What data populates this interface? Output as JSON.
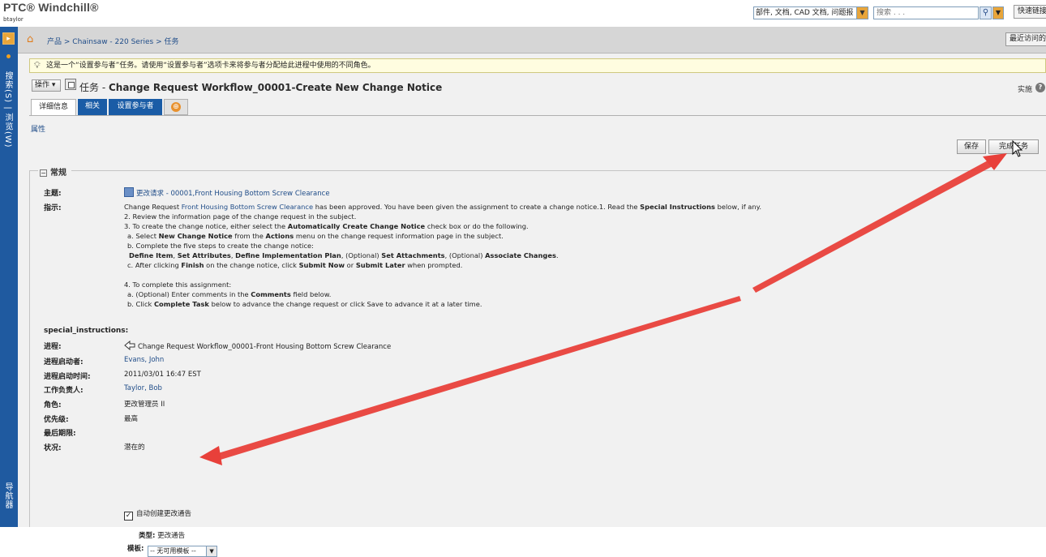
{
  "header": {
    "logo": "PTC® Windchill®",
    "user": "btaylor",
    "search_type": "部件, 文档, CAD 文档, 问题报",
    "search_placeholder": "搜索 . . .",
    "quick_links": "快速链接"
  },
  "leftnav": {
    "search_browse": "搜索(S) | 浏览(W)",
    "navigator": "导航器"
  },
  "breadcrumb": {
    "items": [
      "产品",
      "Chainsaw - 220 Series",
      "任务"
    ],
    "separator": " > ",
    "recent": "最近访问的"
  },
  "infobar": {
    "message": "这是一个“设置参与者”任务。请使用“设置参与者”选项卡来将参与者分配给此进程中使用的不同角色。"
  },
  "page": {
    "actions_label": "操作",
    "title_lead": "任务 - ",
    "title": "Change Request Workflow_00001-Create New Change Notice",
    "implementation": "实施",
    "tabs": [
      "详细信息",
      "相关",
      "设置参与者"
    ],
    "attributes_link": "属性",
    "save_label": "保存",
    "complete_label": "完成任务"
  },
  "section": {
    "heading": "常规",
    "subject_label": "主题:",
    "subject_link": "更改请求",
    "subject_rest": " - 00001,Front Housing Bottom Screw Clearance",
    "instructions_label": "指示:",
    "special_label": "special_instructions:",
    "process_label": "进程:",
    "process_value": "Change Request Workflow_00001-Front Housing Bottom Screw Clearance",
    "initiator_label": "进程启动者:",
    "initiator_value": "Evans, John",
    "start_time_label": "进程启动时间:",
    "start_time_value": "2011/03/01 16:47 EST",
    "owner_label": "工作负责人:",
    "owner_value": "Taylor, Bob",
    "role_label": "角色:",
    "role_value": "更改管理员 II",
    "priority_label": "优先级:",
    "priority_value": "最高",
    "deadline_label": "最后期限:",
    "status_label": "状况:",
    "status_value": "潜在的",
    "auto_create_label": "自动创建更改通告",
    "auto_create_checked": true,
    "type_label": "类型:",
    "type_value": "更改通告",
    "template_label": "模板:",
    "template_value": "-- 无可用模板 --"
  },
  "instructions": {
    "l1_a": "Change Request ",
    "l1_link": "Front Housing Bottom Screw Clearance",
    "l1_b": " has been approved. You have been given the assignment to create a change notice.1. Read the ",
    "l1_bold": "Special Instructions",
    "l1_c": " below, if any.",
    "l2": "2. Review the information page of the change request in the subject.",
    "l3_a": "3. To create the change notice, either select the ",
    "l3_bold": "Automatically Create Change Notice",
    "l3_b": " check box or do the following.",
    "l4_a": "  a. Select ",
    "l4_bold1": "New Change Notice",
    "l4_b": " from the ",
    "l4_bold2": "Actions",
    "l4_c": " menu on the change request information page in the subject.",
    "l5": "  b. Complete the five steps to create the change notice:",
    "l6_bold1": "Define Item",
    "l6_s1": ", ",
    "l6_bold2": "Set Attributes",
    "l6_s2": ", ",
    "l6_bold3": "Define Implementation Plan",
    "l6_s3": ", (Optional) ",
    "l6_bold4": "Set Attachments",
    "l6_s4": ", (Optional) ",
    "l6_bold5": "Associate Changes",
    "l6_s5": ".",
    "l7_a": "  c. After clicking ",
    "l7_bold1": "Finish",
    "l7_b": " on the change notice, click ",
    "l7_bold2": "Submit Now",
    "l7_c": " or ",
    "l7_bold3": "Submit Later",
    "l7_d": " when prompted.",
    "l8": "4. To complete this assignment:",
    "l9_a": "  a. (Optional) Enter comments in the ",
    "l9_bold": "Comments",
    "l9_b": " field below.",
    "l10_a": "  b. Click ",
    "l10_bold": "Complete Task",
    "l10_b": " below to advance the change request or click Save to advance it at a later time."
  },
  "colors": {
    "nav_blue": "#1f5aa0",
    "tab_blue": "#1a5ca6",
    "link_blue": "#1f4c88",
    "annotation_red": "#e8403a",
    "accent_orange": "#e8912e"
  },
  "icons": [
    "home-icon",
    "bulb-icon",
    "task-icon",
    "help-icon",
    "subject-icon",
    "process-icon",
    "collapse-icon",
    "search-icon",
    "checkbox-icon"
  ]
}
